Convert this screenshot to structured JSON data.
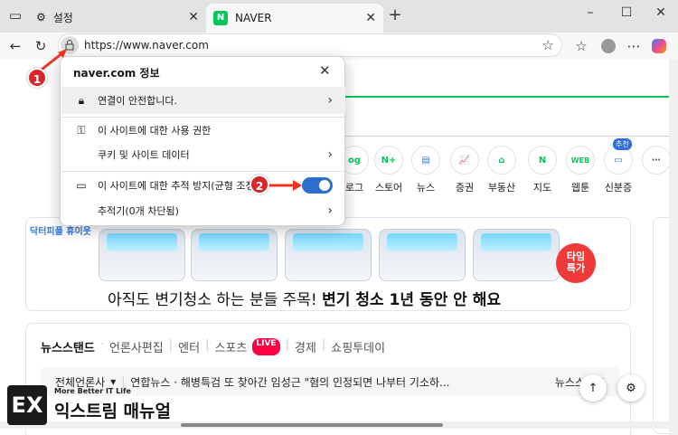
{
  "tabs": [
    {
      "title": "설정",
      "close": "✕"
    },
    {
      "title": "NAVER",
      "close": "✕"
    }
  ],
  "new_tab": "+",
  "window": {
    "minimize": "–",
    "maximize": "☐",
    "close": "✕"
  },
  "address": {
    "url": "https://www.naver.com"
  },
  "popup": {
    "title": "naver.com 정보",
    "close": "✕",
    "connection": "연결이 안전합니다.",
    "permissions": "이 사이트에 대한 사용 권한",
    "cookies": "쿠키 및 사이트 데이터",
    "tracking": "이 사이트에 대한 추적 방지(균형 조정)",
    "trackers": "추적기(0개 차단됨)",
    "tracking_enabled": true
  },
  "badges": [
    "1",
    "2"
  ],
  "services": [
    "로그",
    "스토어",
    "뉴스",
    "증권",
    "부동산",
    "지도",
    "웹툰",
    "신분증"
  ],
  "service_extra": "추천",
  "banner": {
    "brand": "닥터피플 휴이웃",
    "text_normal": "아직도 변기청소 하는 분들 주목!",
    "text_bold": "변기 청소 1년 동안 안 해요",
    "timesale": "타임\n특가"
  },
  "news": {
    "tabs": [
      "뉴스스탠드",
      "언론사편집",
      "엔터",
      "스포츠",
      "경제",
      "쇼핑투데이"
    ],
    "live": "LIVE",
    "row_source": "전체언론사",
    "row_headline": "연합뉴스 · 해병특검 또 찾아간 임성근 \"혐의 인정되면 나부터 기소하...",
    "row_right": "뉴스스탠드"
  },
  "logo": {
    "mark": "EX",
    "tagline": "More Better IT Life",
    "name": "익스트림 매뉴얼"
  }
}
